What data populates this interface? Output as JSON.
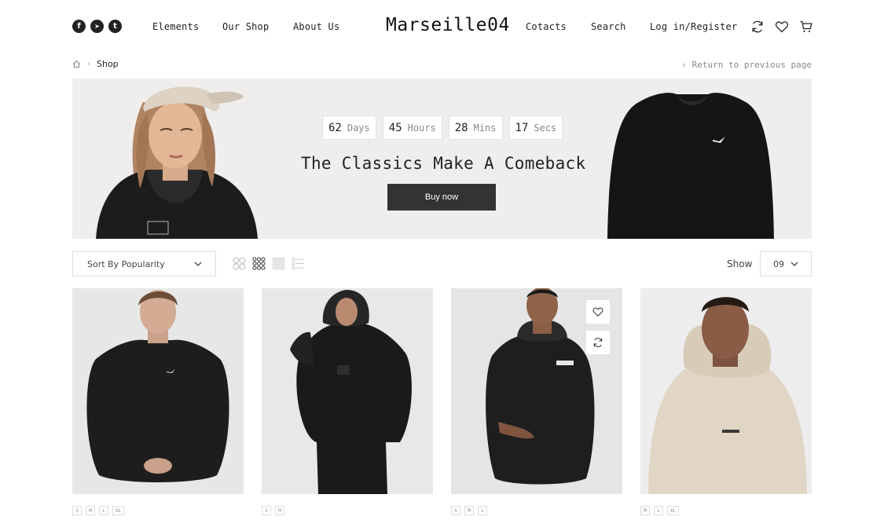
{
  "header": {
    "logo": "Marseille04",
    "nav": [
      "Elements",
      "Our Shop",
      "About Us",
      "Cotacts",
      "Search",
      "Log in/Register"
    ],
    "socials": [
      {
        "icon": "facebook-icon",
        "glyph": "f"
      },
      {
        "icon": "telegram-icon",
        "glyph": "➤"
      },
      {
        "icon": "twitter-icon",
        "glyph": "t"
      }
    ],
    "icons": [
      "refresh-icon",
      "heart-icon",
      "cart-icon"
    ]
  },
  "breadcrumb": {
    "home_icon": "home-icon",
    "separator": "›",
    "current": "Shop",
    "back_label": "‹ Return to previous page"
  },
  "banner": {
    "countdown": [
      {
        "value": "62",
        "unit": "Days"
      },
      {
        "value": "45",
        "unit": "Hours"
      },
      {
        "value": "28",
        "unit": "Mins"
      },
      {
        "value": "17",
        "unit": "Secs"
      }
    ],
    "title": "The Classics Make A Comeback",
    "cta": "Buy now"
  },
  "toolbar": {
    "sort_value": "Sort By Popularity",
    "views": [
      "grid-2-icon",
      "grid-3-icon",
      "grid-4-icon",
      "list-icon"
    ],
    "show_label": "Show",
    "show_value": "09"
  },
  "products": [
    {
      "sizes": [
        "S",
        "M",
        "L",
        "XL"
      ],
      "color": "#2a2a2a",
      "garment": "sweatshirt"
    },
    {
      "sizes": [
        "S",
        "M"
      ],
      "color": "#232323",
      "garment": "hoodie"
    },
    {
      "sizes": [
        "S",
        "M",
        "L"
      ],
      "color": "#272727",
      "garment": "hoodie",
      "actions": [
        "heart-icon",
        "compare-icon"
      ]
    },
    {
      "sizes": [
        "M",
        "L",
        "XL"
      ],
      "color": "#e2d8c8",
      "garment": "hoodie"
    }
  ],
  "colors": {
    "text": "#222222",
    "muted": "#888888",
    "button": "#333333",
    "banner_bg": "#efeeec",
    "card_bg": "#eaeaea"
  }
}
